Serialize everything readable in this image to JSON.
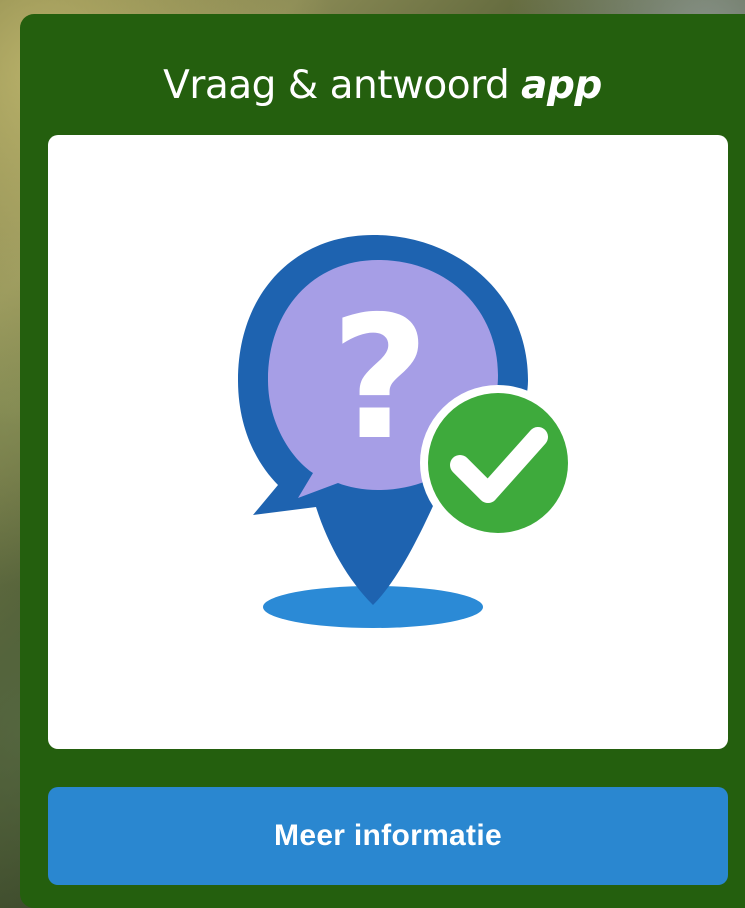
{
  "card": {
    "title_main": "Vraag & antwoord ",
    "title_emphasis": "app",
    "background_color": "#245f0e"
  },
  "illustration": {
    "icon": "question-location-pin-with-checkmark",
    "pin_outer_color": "#1e63b0",
    "bubble_color": "#a69ee6",
    "shadow_color": "#2b8ad6",
    "check_badge_color": "#3eaa3c"
  },
  "button": {
    "label": "Meer informatie",
    "color": "#2a87d0"
  }
}
